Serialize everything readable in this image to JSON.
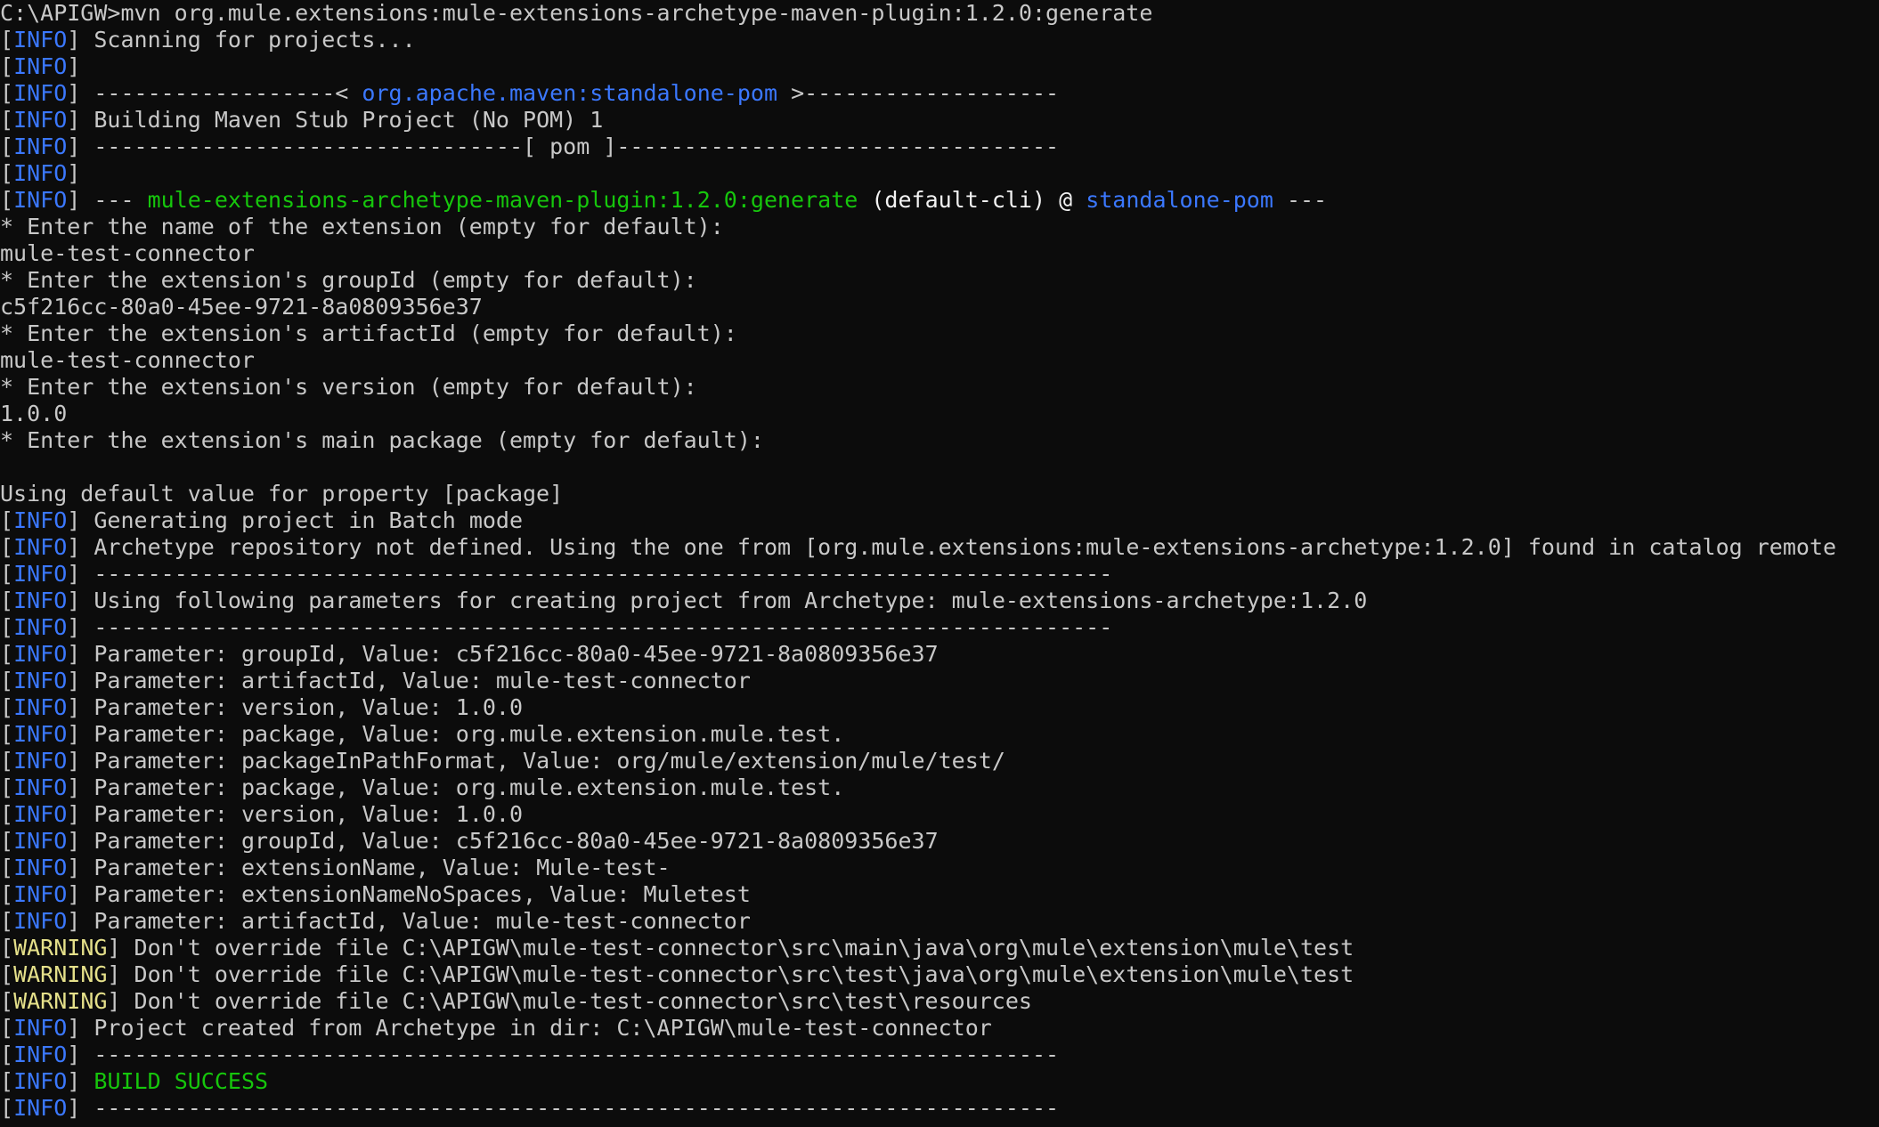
{
  "console": {
    "lines": [
      [
        {
          "t": "C:\\APIGW>mvn org.mule.extensions:mule-extensions-archetype-maven-plugin:1.2.0:generate",
          "c": "text"
        }
      ],
      [
        {
          "t": "[",
          "c": "text"
        },
        {
          "t": "INFO",
          "c": "tag"
        },
        {
          "t": "] Scanning for projects...",
          "c": "text"
        }
      ],
      [
        {
          "t": "[",
          "c": "text"
        },
        {
          "t": "INFO",
          "c": "tag"
        },
        {
          "t": "]",
          "c": "text"
        }
      ],
      [
        {
          "t": "[",
          "c": "text"
        },
        {
          "t": "INFO",
          "c": "tag"
        },
        {
          "t": "] ------------------< ",
          "c": "text"
        },
        {
          "t": "org.apache.maven:standalone-pom",
          "c": "blue"
        },
        {
          "t": " >-------------------",
          "c": "text"
        }
      ],
      [
        {
          "t": "[",
          "c": "text"
        },
        {
          "t": "INFO",
          "c": "tag"
        },
        {
          "t": "] Building Maven Stub Project (No POM) 1",
          "c": "text"
        }
      ],
      [
        {
          "t": "[",
          "c": "text"
        },
        {
          "t": "INFO",
          "c": "tag"
        },
        {
          "t": "] --------------------------------[ pom ]---------------------------------",
          "c": "text"
        }
      ],
      [
        {
          "t": "[",
          "c": "text"
        },
        {
          "t": "INFO",
          "c": "tag"
        },
        {
          "t": "]",
          "c": "text"
        }
      ],
      [
        {
          "t": "[",
          "c": "text"
        },
        {
          "t": "INFO",
          "c": "tag"
        },
        {
          "t": "] --- ",
          "c": "text"
        },
        {
          "t": "mule-extensions-archetype-maven-plugin:1.2.0:generate",
          "c": "green"
        },
        {
          "t": " (default-cli) @ ",
          "c": "white"
        },
        {
          "t": "standalone-pom",
          "c": "blue"
        },
        {
          "t": " ---",
          "c": "text"
        }
      ],
      [
        {
          "t": "* Enter the name of the extension (empty for default):",
          "c": "text"
        }
      ],
      [
        {
          "t": "mule-test-connector",
          "c": "text"
        }
      ],
      [
        {
          "t": "* Enter the extension's groupId (empty for default):",
          "c": "text"
        }
      ],
      [
        {
          "t": "c5f216cc-80a0-45ee-9721-8a0809356e37",
          "c": "text"
        }
      ],
      [
        {
          "t": "* Enter the extension's artifactId (empty for default):",
          "c": "text"
        }
      ],
      [
        {
          "t": "mule-test-connector",
          "c": "text"
        }
      ],
      [
        {
          "t": "* Enter the extension's version (empty for default):",
          "c": "text"
        }
      ],
      [
        {
          "t": "1.0.0",
          "c": "text"
        }
      ],
      [
        {
          "t": "* Enter the extension's main package (empty for default):",
          "c": "text"
        }
      ],
      [
        {
          "t": "",
          "c": "text"
        }
      ],
      [
        {
          "t": "Using default value for property [package]",
          "c": "text"
        }
      ],
      [
        {
          "t": "[",
          "c": "text"
        },
        {
          "t": "INFO",
          "c": "tag"
        },
        {
          "t": "] Generating project in Batch mode",
          "c": "text"
        }
      ],
      [
        {
          "t": "[",
          "c": "text"
        },
        {
          "t": "INFO",
          "c": "tag"
        },
        {
          "t": "] Archetype repository not defined. Using the one from [org.mule.extensions:mule-extensions-archetype:1.2.0] found in catalog remote",
          "c": "text"
        }
      ],
      [
        {
          "t": "[",
          "c": "text"
        },
        {
          "t": "INFO",
          "c": "tag"
        },
        {
          "t": "] ----------------------------------------------------------------------------",
          "c": "text"
        }
      ],
      [
        {
          "t": "[",
          "c": "text"
        },
        {
          "t": "INFO",
          "c": "tag"
        },
        {
          "t": "] Using following parameters for creating project from Archetype: mule-extensions-archetype:1.2.0",
          "c": "text"
        }
      ],
      [
        {
          "t": "[",
          "c": "text"
        },
        {
          "t": "INFO",
          "c": "tag"
        },
        {
          "t": "] ----------------------------------------------------------------------------",
          "c": "text"
        }
      ],
      [
        {
          "t": "[",
          "c": "text"
        },
        {
          "t": "INFO",
          "c": "tag"
        },
        {
          "t": "] Parameter: groupId, Value: c5f216cc-80a0-45ee-9721-8a0809356e37",
          "c": "text"
        }
      ],
      [
        {
          "t": "[",
          "c": "text"
        },
        {
          "t": "INFO",
          "c": "tag"
        },
        {
          "t": "] Parameter: artifactId, Value: mule-test-connector",
          "c": "text"
        }
      ],
      [
        {
          "t": "[",
          "c": "text"
        },
        {
          "t": "INFO",
          "c": "tag"
        },
        {
          "t": "] Parameter: version, Value: 1.0.0",
          "c": "text"
        }
      ],
      [
        {
          "t": "[",
          "c": "text"
        },
        {
          "t": "INFO",
          "c": "tag"
        },
        {
          "t": "] Parameter: package, Value: org.mule.extension.mule.test.",
          "c": "text"
        }
      ],
      [
        {
          "t": "[",
          "c": "text"
        },
        {
          "t": "INFO",
          "c": "tag"
        },
        {
          "t": "] Parameter: packageInPathFormat, Value: org/mule/extension/mule/test/",
          "c": "text"
        }
      ],
      [
        {
          "t": "[",
          "c": "text"
        },
        {
          "t": "INFO",
          "c": "tag"
        },
        {
          "t": "] Parameter: package, Value: org.mule.extension.mule.test.",
          "c": "text"
        }
      ],
      [
        {
          "t": "[",
          "c": "text"
        },
        {
          "t": "INFO",
          "c": "tag"
        },
        {
          "t": "] Parameter: version, Value: 1.0.0",
          "c": "text"
        }
      ],
      [
        {
          "t": "[",
          "c": "text"
        },
        {
          "t": "INFO",
          "c": "tag"
        },
        {
          "t": "] Parameter: groupId, Value: c5f216cc-80a0-45ee-9721-8a0809356e37",
          "c": "text"
        }
      ],
      [
        {
          "t": "[",
          "c": "text"
        },
        {
          "t": "INFO",
          "c": "tag"
        },
        {
          "t": "] Parameter: extensionName, Value: Mule-test-",
          "c": "text"
        }
      ],
      [
        {
          "t": "[",
          "c": "text"
        },
        {
          "t": "INFO",
          "c": "tag"
        },
        {
          "t": "] Parameter: extensionNameNoSpaces, Value: Muletest",
          "c": "text"
        }
      ],
      [
        {
          "t": "[",
          "c": "text"
        },
        {
          "t": "INFO",
          "c": "tag"
        },
        {
          "t": "] Parameter: artifactId, Value: mule-test-connector",
          "c": "text"
        }
      ],
      [
        {
          "t": "[",
          "c": "text"
        },
        {
          "t": "WARNING",
          "c": "warn"
        },
        {
          "t": "] Don't override file C:\\APIGW\\mule-test-connector\\src\\main\\java\\org\\mule\\extension\\mule\\test",
          "c": "text"
        }
      ],
      [
        {
          "t": "[",
          "c": "text"
        },
        {
          "t": "WARNING",
          "c": "warn"
        },
        {
          "t": "] Don't override file C:\\APIGW\\mule-test-connector\\src\\test\\java\\org\\mule\\extension\\mule\\test",
          "c": "text"
        }
      ],
      [
        {
          "t": "[",
          "c": "text"
        },
        {
          "t": "WARNING",
          "c": "warn"
        },
        {
          "t": "] Don't override file C:\\APIGW\\mule-test-connector\\src\\test\\resources",
          "c": "text"
        }
      ],
      [
        {
          "t": "[",
          "c": "text"
        },
        {
          "t": "INFO",
          "c": "tag"
        },
        {
          "t": "] Project created from Archetype in dir: C:\\APIGW\\mule-test-connector",
          "c": "text"
        }
      ],
      [
        {
          "t": "[",
          "c": "text"
        },
        {
          "t": "INFO",
          "c": "tag"
        },
        {
          "t": "] ------------------------------------------------------------------------",
          "c": "text"
        }
      ],
      [
        {
          "t": "[",
          "c": "text"
        },
        {
          "t": "INFO",
          "c": "tag"
        },
        {
          "t": "] ",
          "c": "text"
        },
        {
          "t": "BUILD SUCCESS",
          "c": "green"
        }
      ],
      [
        {
          "t": "[",
          "c": "text"
        },
        {
          "t": "INFO",
          "c": "tag"
        },
        {
          "t": "] ------------------------------------------------------------------------",
          "c": "text"
        }
      ]
    ]
  }
}
